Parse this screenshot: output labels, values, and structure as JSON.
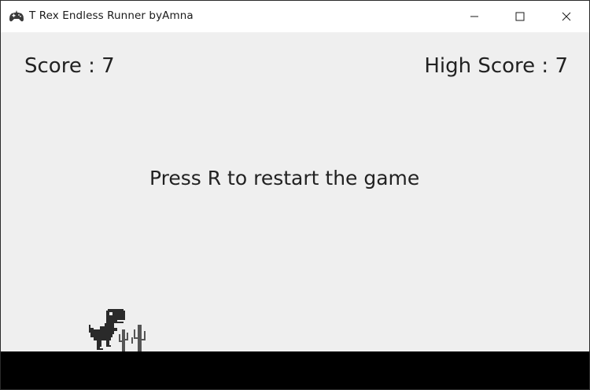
{
  "window": {
    "title": "T Rex Endless Runner byAmna",
    "app_icon": "gamepad-icon",
    "controls": [
      "minimize-icon",
      "maximize-icon",
      "close-icon"
    ]
  },
  "hud": {
    "score_text": "Score : 7",
    "high_score_text": "High Score : 7"
  },
  "message": {
    "restart_text": "Press R to restart the game"
  },
  "sprites": {
    "player": "t-rex-dinosaur",
    "obstacle": "cactus-group"
  },
  "colors": {
    "background": "#efefef",
    "ground": "#000000",
    "dino": "#2a2a2a",
    "cactus": "#555555",
    "text": "#222222"
  }
}
